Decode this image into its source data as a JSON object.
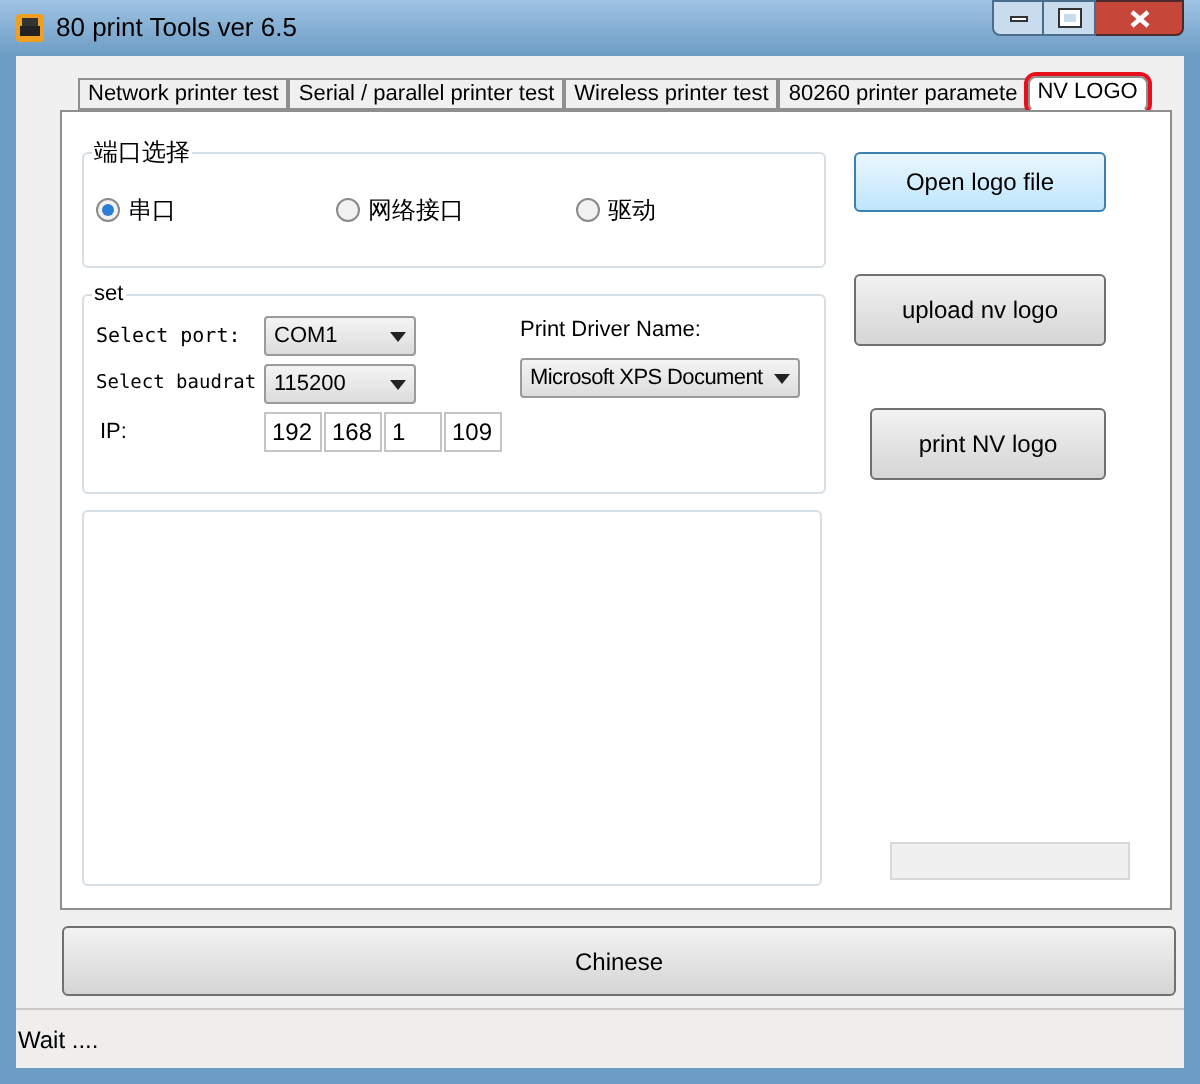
{
  "window": {
    "title": "80 print Tools ver 6.5"
  },
  "tabs": [
    {
      "label": "Network printer test",
      "selected": false
    },
    {
      "label": "Serial / parallel printer test",
      "selected": false
    },
    {
      "label": "Wireless printer test",
      "selected": false
    },
    {
      "label": "80260 printer paramete",
      "selected": false
    },
    {
      "label": "NV LOGO",
      "selected": true,
      "highlighted": true
    }
  ],
  "port_group": {
    "title": "端口选择",
    "options": [
      {
        "label": "串口",
        "selected": true
      },
      {
        "label": "网络接口",
        "selected": false
      },
      {
        "label": "驱动",
        "selected": false
      }
    ]
  },
  "set_group": {
    "title": "set",
    "port_label": "Select port:",
    "port_value": "COM1",
    "baud_label": "Select baudrat",
    "baud_value": "115200",
    "ip_label": "IP:",
    "ip": [
      "192",
      "168",
      "1",
      "109"
    ],
    "driver_label": "Print Driver Name:",
    "driver_value": "Microsoft XPS Document"
  },
  "buttons": [
    {
      "label": "Open logo file",
      "focused": true
    },
    {
      "label": "upload nv logo",
      "focused": false
    },
    {
      "label": "print NV logo",
      "focused": false
    }
  ],
  "progress": {
    "level": 0
  },
  "bottom_button": "Chinese",
  "status_bar": "Wait ...."
}
